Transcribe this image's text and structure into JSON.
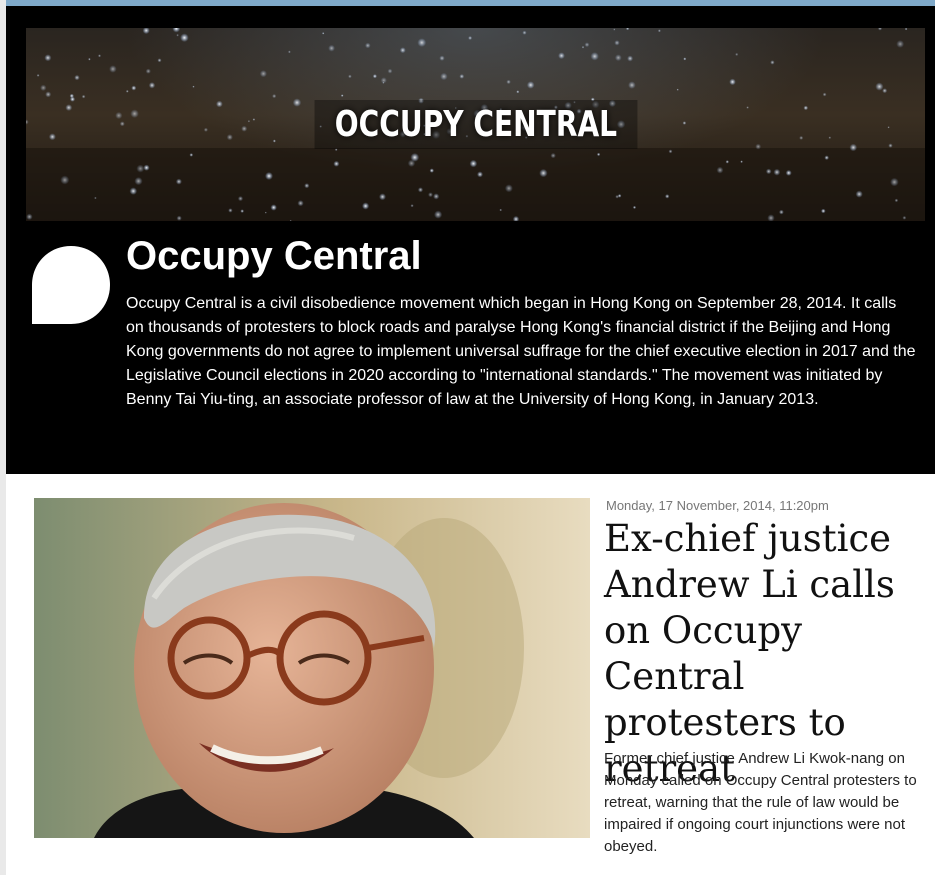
{
  "topic": {
    "banner_title": "OCCUPY CENTRAL",
    "title": "Occupy Central",
    "description": "Occupy Central is a civil disobedience movement which began in Hong Kong on September 28, 2014. It calls on thousands of protesters to block roads and paralyse Hong Kong's financial district if the Beijing and Hong Kong governments do not agree to implement universal suffrage for the chief executive election in 2017 and the Legislative Council elections in 2020 according to \"international standards.\" The movement was initiated by Benny Tai Yiu-ting, an associate professor of law at the University of Hong Kong, in January 2013."
  },
  "article": {
    "date": "Monday, 17 November, 2014, 11:20pm",
    "headline": "Ex-chief justice Andrew Li calls on Occupy Central protesters to retreat",
    "summary": "Former chief justice Andrew Li Kwok-nang on Monday called on Occupy Central protesters to retreat, warning that the rule of law would be impaired if ongoing court injunctions were not obeyed."
  },
  "colors": {
    "header_bg": "#000000",
    "top_rule": "#7fa9c9",
    "date_text": "#777777"
  },
  "icons": {
    "logo": "speech-bubble-icon"
  }
}
